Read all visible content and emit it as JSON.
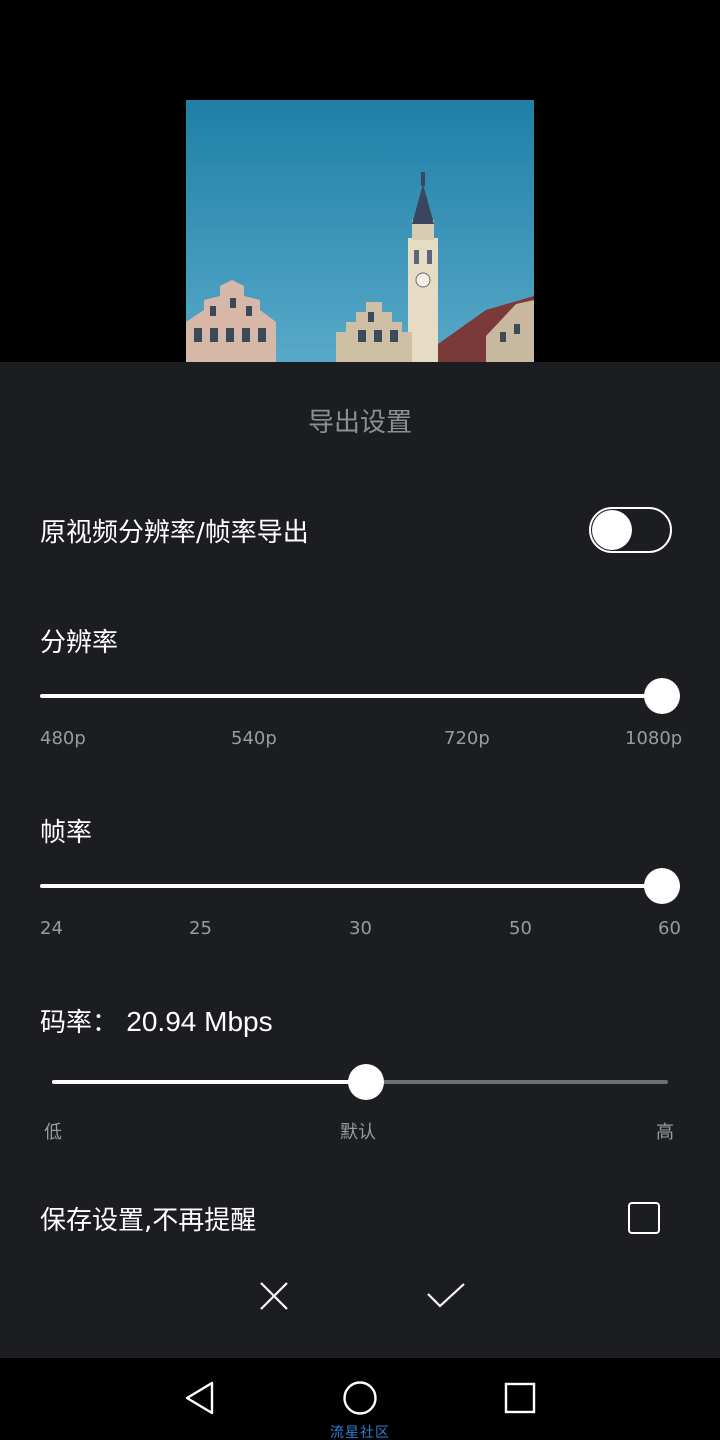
{
  "preview": {
    "sky_color": "#3a8fb0",
    "description_icon": "city-clock-tower-image"
  },
  "panel": {
    "title": "导出设置",
    "original_toggle": {
      "label": "原视频分辨率/帧率导出",
      "on": false
    },
    "resolution": {
      "label": "分辨率",
      "ticks": [
        "480p",
        "540p",
        "720p",
        "1080p"
      ],
      "selected": "1080p",
      "level": 1.0
    },
    "framerate": {
      "label": "帧率",
      "ticks": [
        "24",
        "25",
        "30",
        "50",
        "60"
      ],
      "selected": "60",
      "level": 1.0
    },
    "bitrate": {
      "label": "码率：",
      "value": "20.94 Mbps",
      "ticks": [
        "低",
        "默认",
        "高"
      ],
      "level": 0.5
    },
    "save_settings": {
      "label": "保存设置,不再提醒",
      "checked": false
    },
    "actions": {
      "cancel_icon": "close-icon",
      "confirm_icon": "check-icon"
    }
  },
  "nav": {
    "back_icon": "back-triangle-icon",
    "home_icon": "home-circle-icon",
    "recents_icon": "recents-square-icon"
  },
  "watermark": "流星社区",
  "colors": {
    "panel_bg": "#1c1d21",
    "title_gray": "#8e8f94",
    "tick_gray": "#9a9ba0",
    "watermark_blue": "#2f7fd6"
  }
}
